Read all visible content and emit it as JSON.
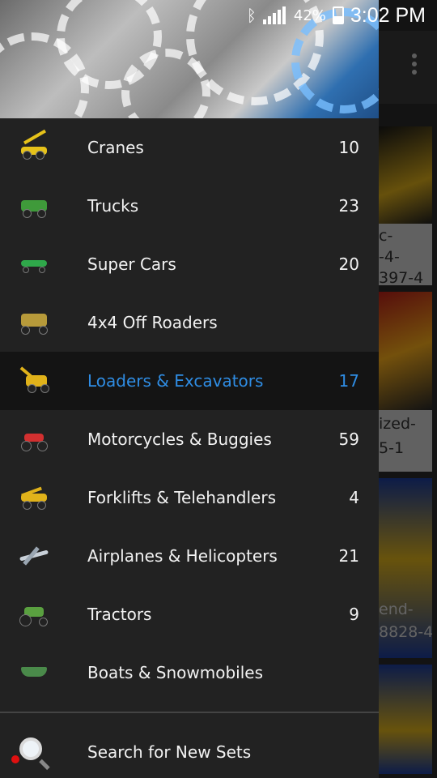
{
  "status_bar": {
    "battery_percent": "42%",
    "time": "3:02 PM",
    "icons": [
      "bluetooth-icon",
      "signal-icon",
      "battery-icon"
    ]
  },
  "drawer": {
    "items": [
      {
        "label": "Cranes",
        "count": "10",
        "icon": "crane-icon",
        "color": "#e6c21a"
      },
      {
        "label": "Trucks",
        "count": "23",
        "icon": "truck-icon",
        "color": "#3f9a3a"
      },
      {
        "label": "Super Cars",
        "count": "20",
        "icon": "supercar-icon",
        "color": "#2fa84a"
      },
      {
        "label": "4x4 Off Roaders",
        "count": "",
        "icon": "offroader-icon",
        "color": "#b79a3a"
      },
      {
        "label": "Loaders & Excavators",
        "count": "17",
        "icon": "excavator-icon",
        "color": "#e0b21a",
        "selected": true
      },
      {
        "label": "Motorcycles & Buggies",
        "count": "59",
        "icon": "motorcycle-icon",
        "color": "#d23030"
      },
      {
        "label": "Forklifts & Telehandlers",
        "count": "4",
        "icon": "forklift-icon",
        "color": "#e0b21a"
      },
      {
        "label": "Airplanes & Helicopters",
        "count": "21",
        "icon": "airplane-icon",
        "color": "#c8d0d8"
      },
      {
        "label": "Tractors",
        "count": "9",
        "icon": "tractor-icon",
        "color": "#5aa040"
      },
      {
        "label": "Boats & Snowmobiles",
        "count": "",
        "icon": "boat-icon",
        "color": "#4a8a4a"
      }
    ],
    "search": {
      "label": "Search for New Sets",
      "icon": "magnifier-icon"
    }
  },
  "background_list": {
    "cards": [
      {
        "text": "c-\n-4-\n397-4"
      },
      {
        "text": "ized-\n5-1"
      },
      {
        "text": "end-\n8828-4"
      },
      {
        "text": ""
      }
    ]
  },
  "colors": {
    "accent": "#2f8de4",
    "drawer_bg": "#222222",
    "selected_bg": "#141414"
  }
}
